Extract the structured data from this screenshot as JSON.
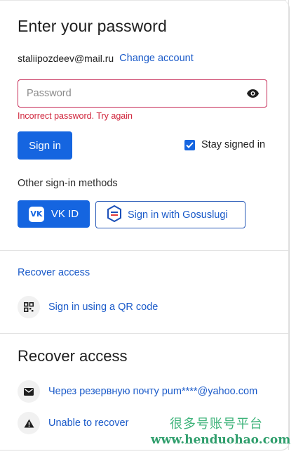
{
  "heading": "Enter your password",
  "account": {
    "email": "staliipozdeev@mail.ru",
    "change_label": "Change account"
  },
  "password": {
    "placeholder": "Password",
    "value": "",
    "error": "Incorrect password. Try again",
    "toggle_icon": "eye-icon"
  },
  "sign_in_label": "Sign in",
  "stay_signed_in": {
    "label": "Stay signed in",
    "checked": true
  },
  "other_methods": {
    "label": "Other sign-in methods",
    "vk_label": "VK ID",
    "gosuslugi_label": "Sign in with Gosuslugi"
  },
  "links": {
    "recover": "Recover access",
    "qr": "Sign in using a QR code"
  },
  "recover_section": {
    "title": "Recover access",
    "items": [
      {
        "label": "Через резервную почту pum****@yahoo.com",
        "icon": "envelope-icon"
      },
      {
        "label": "Unable to recover",
        "icon": "warning-icon"
      }
    ]
  },
  "watermark": {
    "cn": "很多号账号平台",
    "url": "www.henduohao.com"
  },
  "colors": {
    "primary": "#1565e0",
    "link": "#1a5ac9",
    "error": "#d0243b",
    "error_border": "#c62b57",
    "watermark": "#3eb37a"
  }
}
